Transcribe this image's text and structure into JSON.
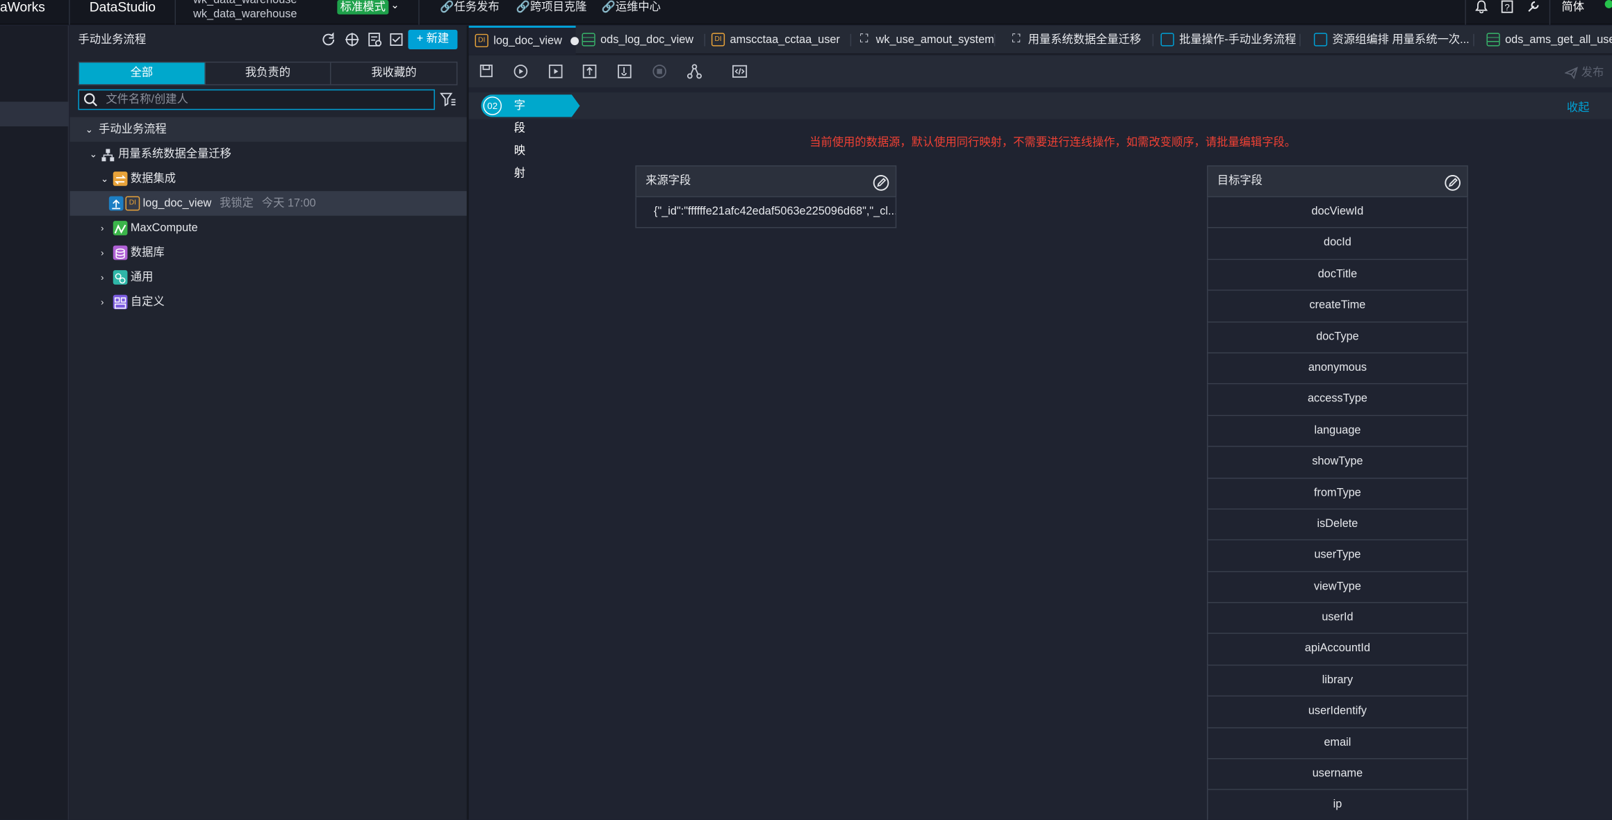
{
  "topbar": {
    "brand": "aWorks",
    "app": "DataStudio",
    "project_line1": "wk_data_warehouse",
    "project_line2": "wk_data_warehouse",
    "mode": "标准模式",
    "nav": [
      "任务发布",
      "跨项目克隆",
      "运维中心"
    ],
    "lang": "简体"
  },
  "panel": {
    "title": "手动业务流程",
    "new_label": "+ 新建",
    "tabs": [
      "全部",
      "我负责的",
      "我收藏的"
    ],
    "search_placeholder": "文件名称/创建人",
    "tree": {
      "root": "手动业务流程",
      "flow": "用量系统数据全量迁移",
      "group": "数据集成",
      "node": "log_doc_view",
      "node_lock": "我锁定",
      "node_time": "今天 17:00",
      "folders": [
        "MaxCompute",
        "数据库",
        "通用",
        "自定义"
      ]
    }
  },
  "file_tabs": [
    {
      "label": "log_doc_view",
      "icon": "di-icon"
    },
    {
      "label": "ods_log_doc_view",
      "icon": "table-icon"
    },
    {
      "label": "amscctaa_cctaa_user",
      "icon": "di-icon"
    },
    {
      "label": "wk_use_amout_system",
      "icon": "flow-icon"
    },
    {
      "label": "用量系统数据全量迁移",
      "icon": "flow-icon"
    },
    {
      "label": "批量操作-手动业务流程",
      "icon": "batch-icon"
    },
    {
      "label": "资源组编排 用量系统一次...",
      "icon": "resource-icon"
    },
    {
      "label": "ods_ams_get_all_user_s",
      "icon": "table-icon"
    }
  ],
  "toolbar": {
    "publish": "发布"
  },
  "step": {
    "num": "02",
    "label": "字段映射",
    "collapse": "收起"
  },
  "warning": "当前使用的数据源，默认使用同行映射，不需要进行连线操作，如需改变顺序，请批量编辑字段。",
  "source": {
    "header": "来源字段",
    "fields": [
      "{\"_id\":\"ffffffe21afc42edaf5063e225096d68\",\"_cl..."
    ]
  },
  "target": {
    "header": "目标字段",
    "fields": [
      "docViewId",
      "docId",
      "docTitle",
      "createTime",
      "docType",
      "anonymous",
      "accessType",
      "language",
      "showType",
      "fromType",
      "isDelete",
      "userType",
      "viewType",
      "userId",
      "apiAccountId",
      "library",
      "userIdentify",
      "email",
      "username",
      "ip"
    ]
  },
  "colors": {
    "accent": "#00a8cc",
    "warning": "#f04134",
    "mode_badge": "#1fa14b"
  }
}
